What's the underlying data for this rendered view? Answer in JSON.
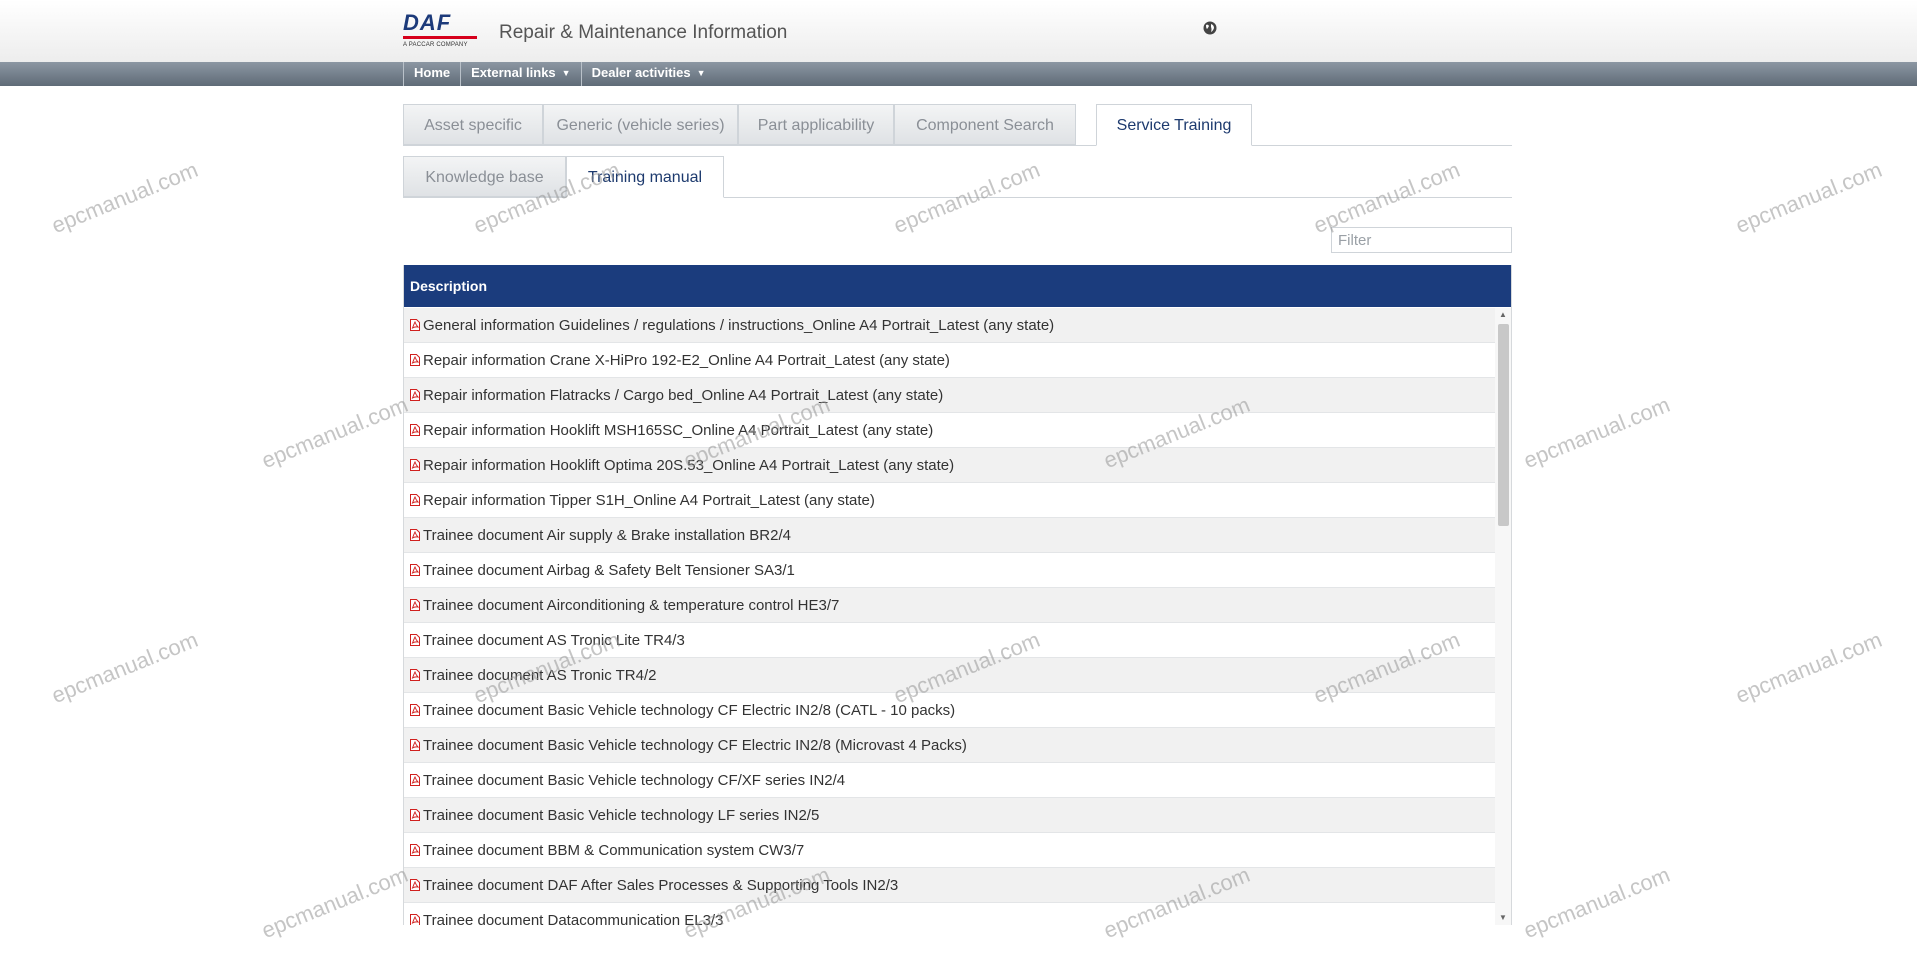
{
  "header": {
    "logo_text": "DAF",
    "logo_subtext": "A PACCAR COMPANY",
    "title": "Repair & Maintenance Information",
    "globe_icon": "globe-icon"
  },
  "nav": {
    "items": [
      {
        "label": "Home"
      },
      {
        "label": "External links"
      },
      {
        "label": "Dealer activities"
      }
    ]
  },
  "tabs": {
    "main": [
      {
        "label": "Asset specific"
      },
      {
        "label": "Generic (vehicle series)"
      },
      {
        "label": "Part applicability"
      },
      {
        "label": "Component Search"
      },
      {
        "label": "Service Training"
      }
    ],
    "sub": [
      {
        "label": "Knowledge base"
      },
      {
        "label": "Training manual"
      }
    ]
  },
  "filter": {
    "placeholder": "Filter",
    "value": ""
  },
  "table": {
    "header": "Description",
    "rows": [
      "General information Guidelines / regulations / instructions_Online A4 Portrait_Latest (any state)",
      "Repair information Crane X-HiPro 192-E2_Online A4 Portrait_Latest (any state)",
      "Repair information Flatracks / Cargo bed_Online A4 Portrait_Latest (any state)",
      "Repair information Hooklift MSH165SC_Online A4 Portrait_Latest (any state)",
      "Repair information Hooklift Optima 20S.53_Online A4 Portrait_Latest (any state)",
      "Repair information Tipper S1H_Online A4 Portrait_Latest (any state)",
      "Trainee document Air supply & Brake installation BR2/4",
      "Trainee document Airbag & Safety Belt Tensioner SA3/1",
      "Trainee document Airconditioning & temperature control HE3/7",
      "Trainee document AS Tronic Lite TR4/3",
      "Trainee document AS Tronic TR4/2",
      "Trainee document Basic Vehicle technology CF Electric IN2/8 (CATL - 10 packs)",
      "Trainee document Basic Vehicle technology CF Electric IN2/8 (Microvast 4 Packs)",
      "Trainee document Basic Vehicle technology CF/XF series IN2/4",
      "Trainee document Basic Vehicle technology LF series IN2/5",
      "Trainee document BBM & Communication system CW3/7",
      "Trainee document DAF After Sales Processes & Supporting Tools IN2/3",
      "Trainee document Datacommunication EL3/3"
    ]
  },
  "watermark": "epcmanual.com",
  "colors": {
    "header_blue": "#1b3c7d",
    "pdf_red": "#d0201e"
  }
}
